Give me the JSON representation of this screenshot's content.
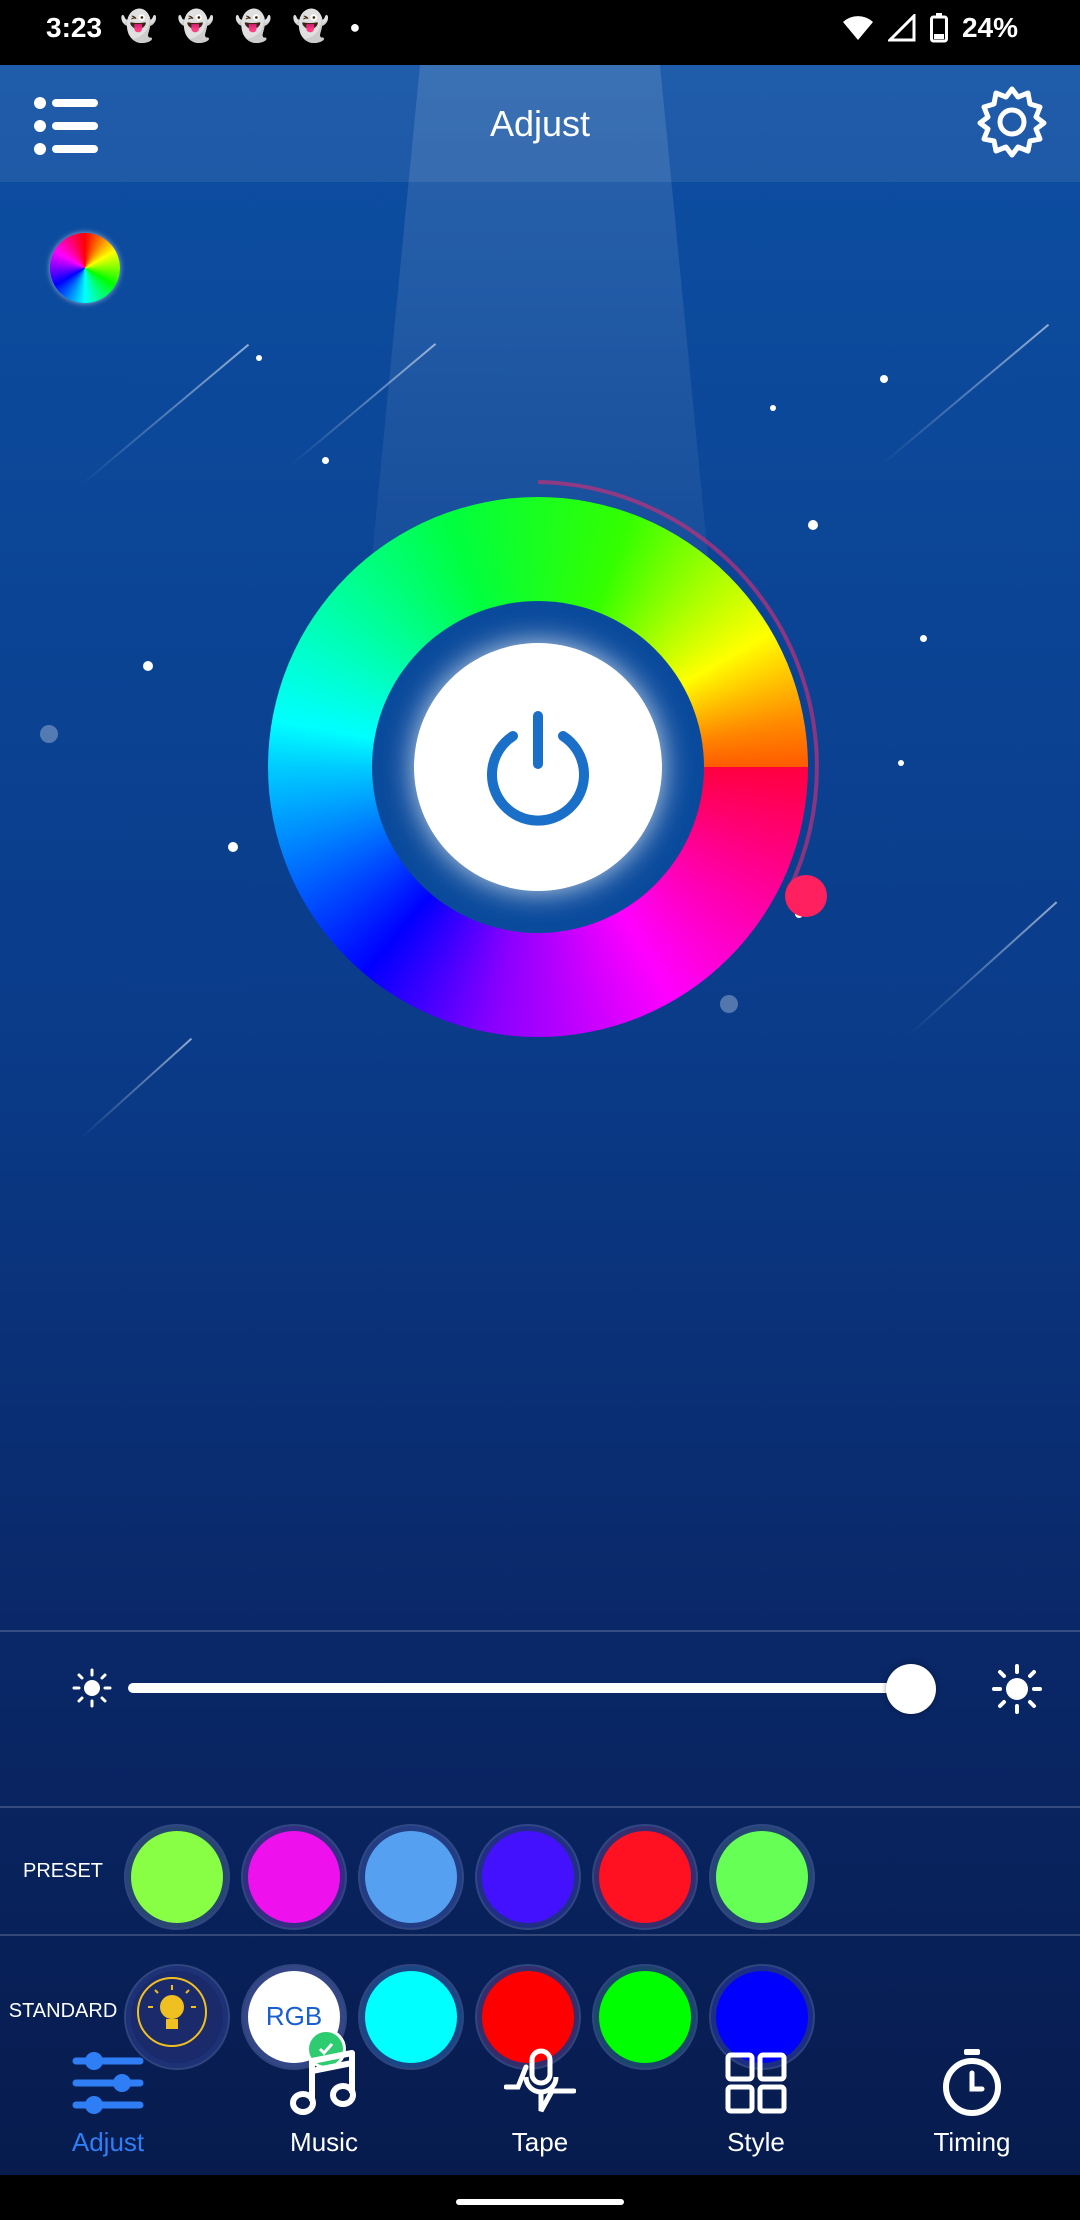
{
  "status_bar": {
    "time": "3:23",
    "battery": "24%",
    "icons": [
      "snapchat-icon",
      "snapchat-icon",
      "snapchat-icon",
      "snapchat-icon",
      "dot-icon",
      "wifi-icon",
      "signal-icon",
      "battery-icon"
    ]
  },
  "header": {
    "title": "Adjust"
  },
  "brightness": {
    "value_percent": 100
  },
  "preset": {
    "label": "PRESET",
    "colors": [
      "#88ff44",
      "#ee11ee",
      "#55a0f0",
      "#4411ff",
      "#ff1122",
      "#66ff55"
    ]
  },
  "standard": {
    "label": "STANDARD",
    "rgb_label": "RGB",
    "colors": [
      "#00ffff",
      "#ff0000",
      "#00ff00",
      "#0000ff"
    ]
  },
  "nav": {
    "items": [
      {
        "label": "Adjust",
        "icon": "sliders-icon",
        "active": true
      },
      {
        "label": "Music",
        "icon": "music-note-icon",
        "active": false
      },
      {
        "label": "Tape",
        "icon": "microphone-icon",
        "active": false
      },
      {
        "label": "Style",
        "icon": "grid-icon",
        "active": false
      },
      {
        "label": "Timing",
        "icon": "timer-icon",
        "active": false
      }
    ]
  },
  "colors": {
    "accent": "#2f7ef5",
    "background_top": "#0d4fa3",
    "background_bottom": "#071b4d"
  }
}
